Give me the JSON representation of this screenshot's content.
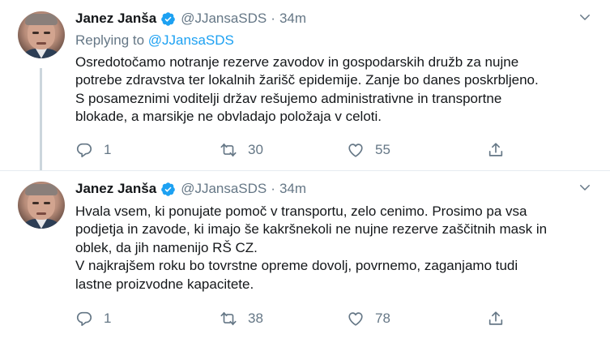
{
  "tweets": [
    {
      "name": "Janez Janša",
      "handle": "@JJansaSDS",
      "separator": "·",
      "time": "34m",
      "replying_prefix": "Replying to",
      "replying_handle": "@JJansaSDS",
      "text": "Osredotočamo notranje rezerve zavodov in gospodarskih družb za nujne\npotrebe zdravstva ter lokalnih žarišč epidemije. Zanje bo danes poskrbljeno.\nS posameznimi voditelji držav rešujemo administrativne in transportne\nblokade, a marsikje ne obvladajo položaja v celoti.",
      "reply_count": "1",
      "retweet_count": "30",
      "like_count": "55"
    },
    {
      "name": "Janez Janša",
      "handle": "@JJansaSDS",
      "separator": "·",
      "time": "34m",
      "text": "Hvala vsem, ki ponujate pomoč v transportu, zelo cenimo. Prosimo pa vsa\npodjetja in zavode, ki imajo še kakršnekoli ne nujne rezerve zaščitnih mask in\noblek, da jih namenijo RŠ CZ.\nV najkrajšem roku bo tovrstne opreme dovolj, povrnemo, zaganjamo tudi\nlastne proizvodne kapacitete.",
      "reply_count": "1",
      "retweet_count": "38",
      "like_count": "78"
    }
  ],
  "icons": {
    "verified": "verified-badge-icon",
    "caret": "chevron-down-icon",
    "reply": "reply-icon",
    "retweet": "retweet-icon",
    "like": "heart-icon",
    "share": "share-icon"
  },
  "colors": {
    "accent": "#1da1f2",
    "secondary_text": "#657786",
    "primary_text": "#14171a",
    "divider": "#e6ecf0",
    "thread_line": "#ccd6dd"
  }
}
